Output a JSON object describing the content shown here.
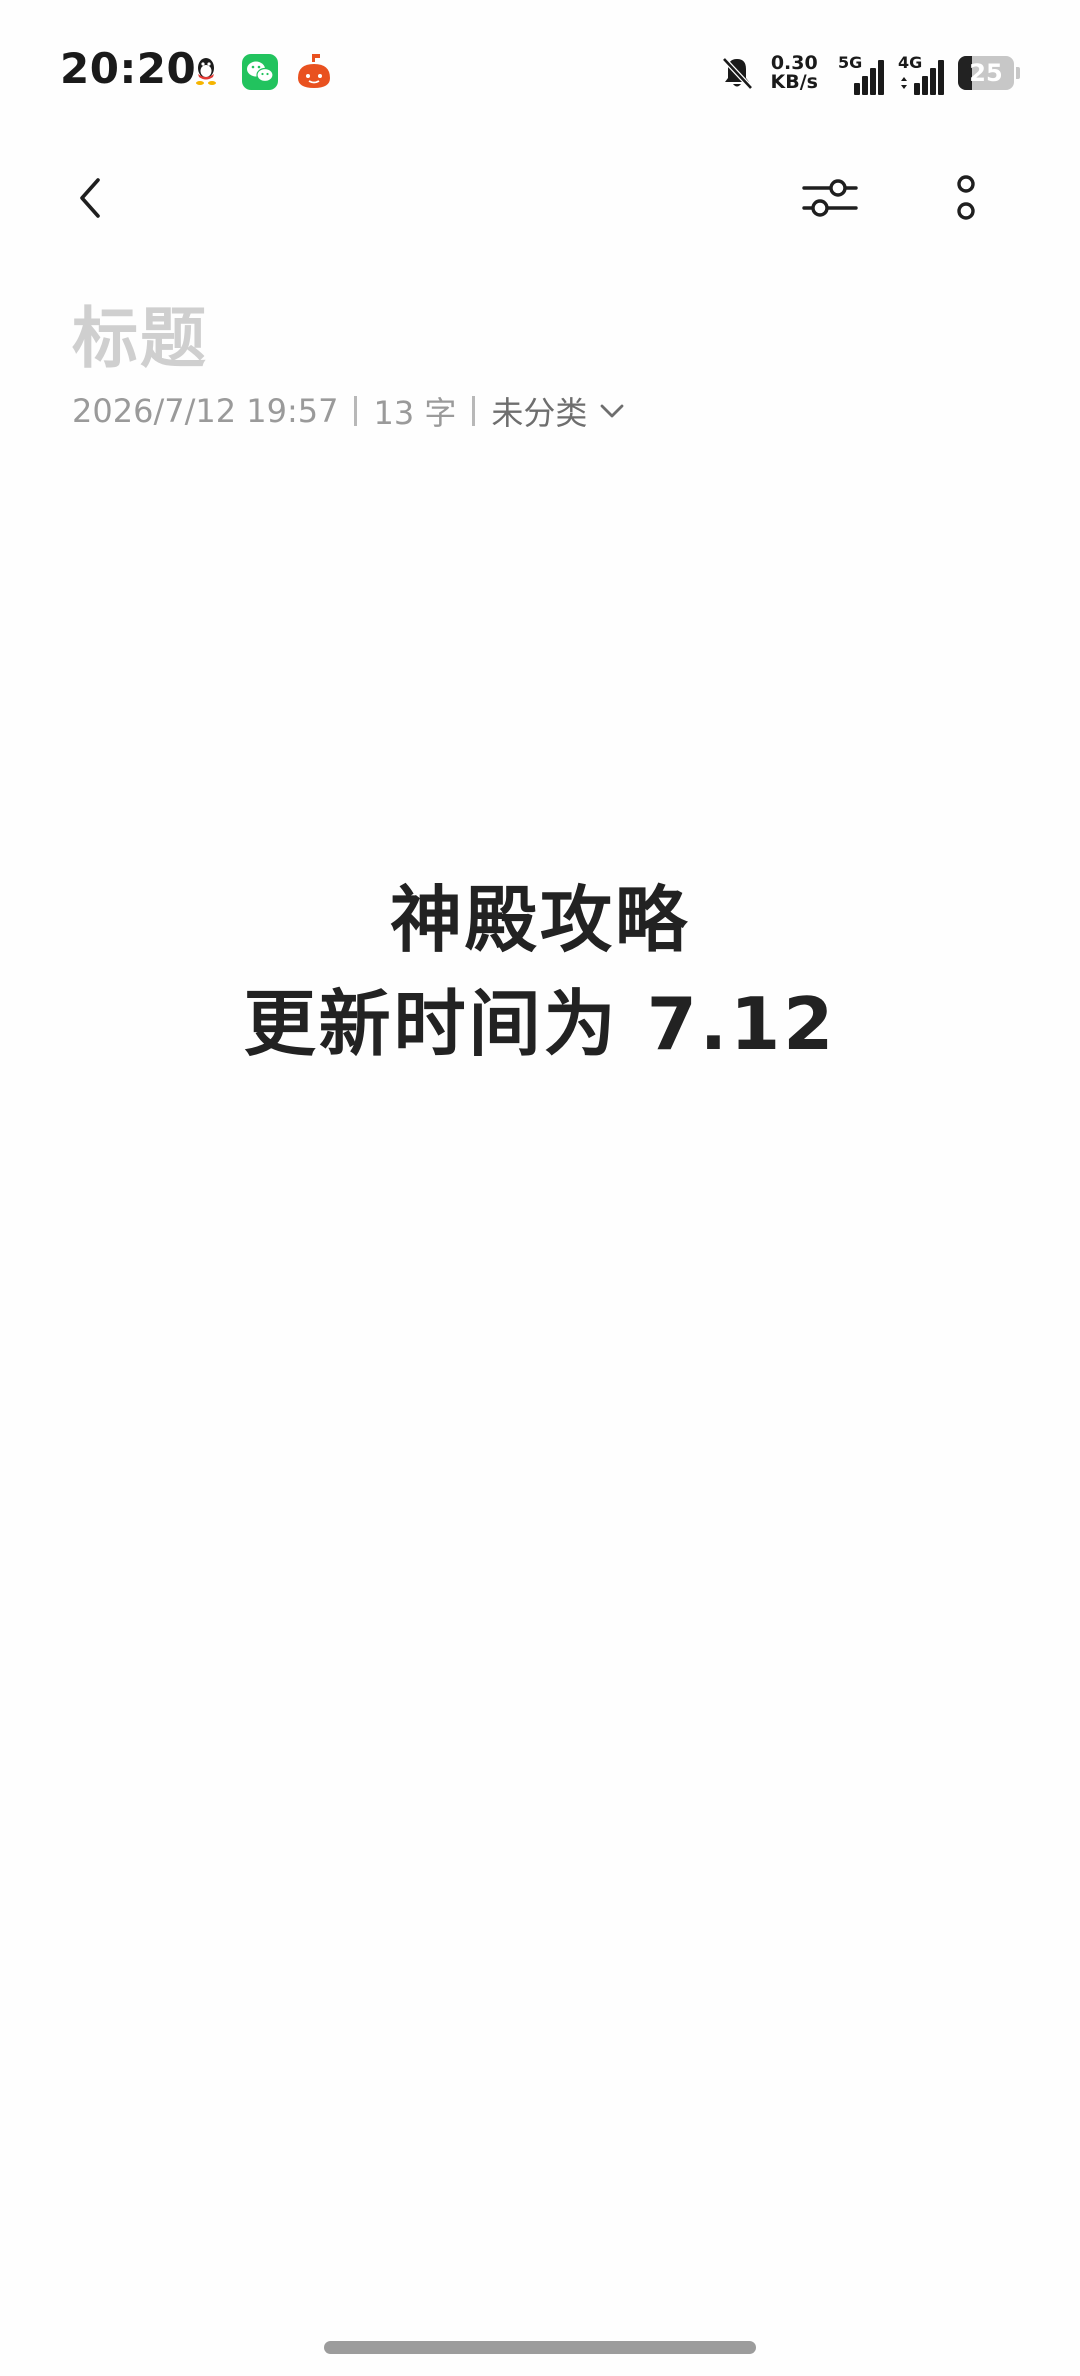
{
  "status_bar": {
    "time": "20:20",
    "net_speed_value": "0.30",
    "net_speed_unit": "KB/s",
    "sim1_label": "5G",
    "sim2_label": "4G",
    "battery_level": "25",
    "battery_fraction": 0.25,
    "notification_icons": [
      "qq-icon",
      "wechat-icon",
      "taobao-icon"
    ]
  },
  "toolbar": {
    "back_icon": "chevron-left-icon",
    "format_icon": "sliders-icon",
    "more_icon": "more-vertical-icon"
  },
  "note": {
    "title_placeholder": "标题",
    "datetime": "2026/7/12 19:57",
    "word_count": "13 字",
    "category": "未分类",
    "content_lines": [
      "神殿攻略",
      "更新时间为 7.12"
    ]
  },
  "colors": {
    "background": "#fefefe",
    "text_primary": "#222222",
    "text_placeholder": "#cfcfcf",
    "text_meta": "#9a9a9a",
    "wechat_green": "#22c35e",
    "taobao_orange": "#e9511f"
  }
}
